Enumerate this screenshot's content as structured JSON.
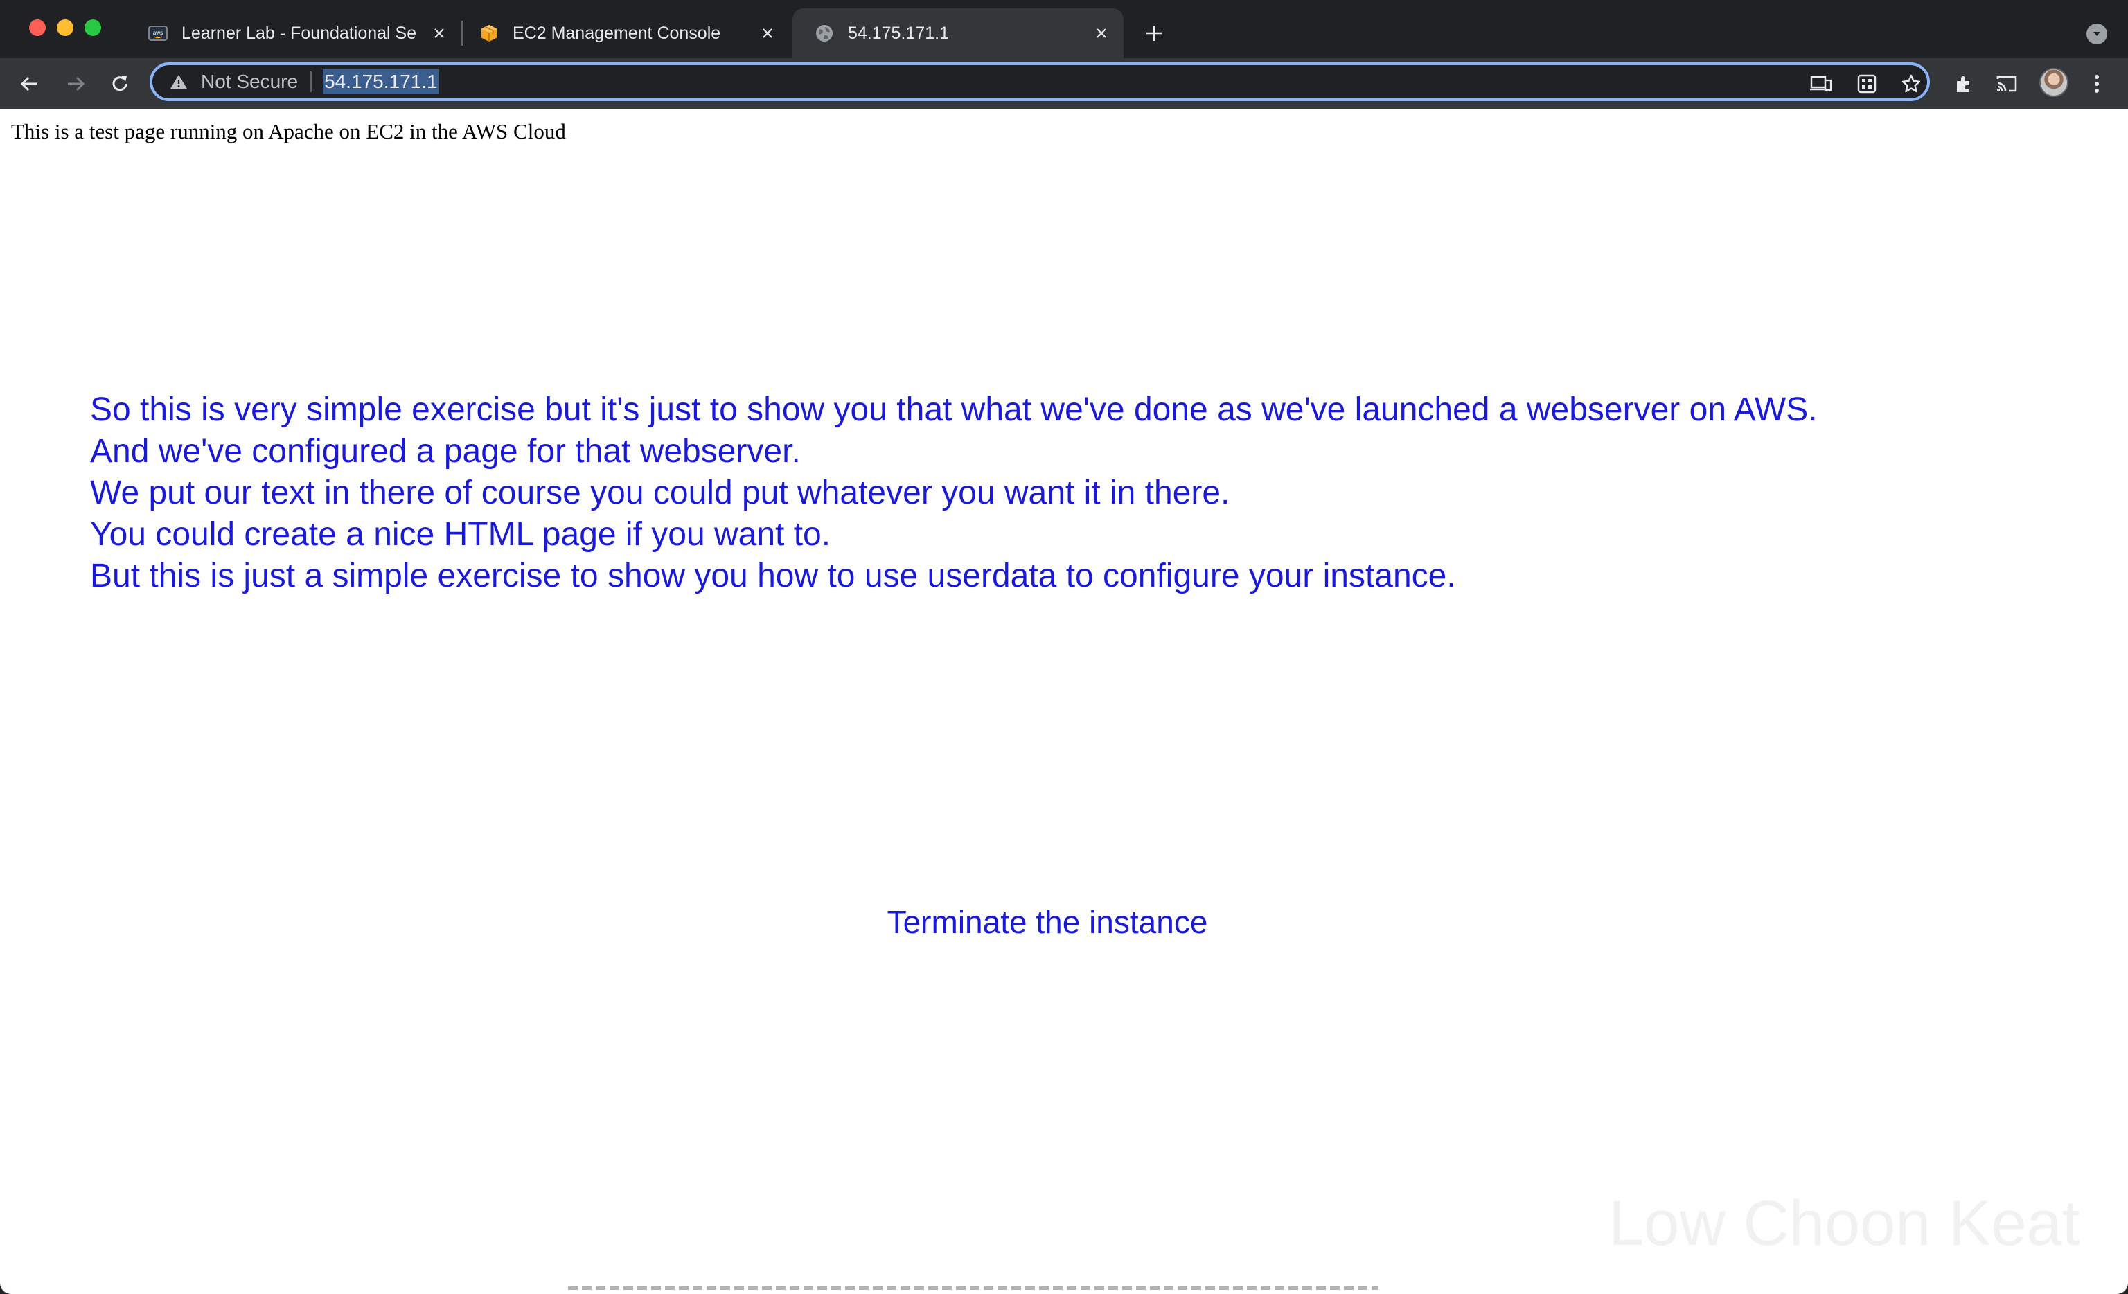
{
  "browser": {
    "tabs": [
      {
        "title": "Learner Lab - Foundational Se",
        "favicon": "aws-icon",
        "active": false
      },
      {
        "title": "EC2 Management Console",
        "favicon": "aws-box-icon",
        "active": false
      },
      {
        "title": "54.175.171.1",
        "favicon": "globe-icon",
        "active": true
      }
    ],
    "address_bar": {
      "security_label": "Not Secure",
      "url": "54.175.171.1"
    },
    "colors": {
      "accent": "#8ab4f8",
      "link_text": "#1a1ad6"
    }
  },
  "page": {
    "intro": "This is a test page running on Apache on EC2 in the AWS Cloud",
    "message_lines": [
      "So this is very simple exercise but it's just to show you that what we've done as we've launched a webserver on AWS.",
      "And we've configured a page for that webserver.",
      "We put our text in there of course you could put whatever you want it in there.",
      "You could create a nice HTML page if you want to.",
      "But this is just a simple exercise to show you how to use userdata to configure your instance."
    ],
    "caption": "Terminate the instance",
    "watermark": "Low Choon Keat"
  }
}
